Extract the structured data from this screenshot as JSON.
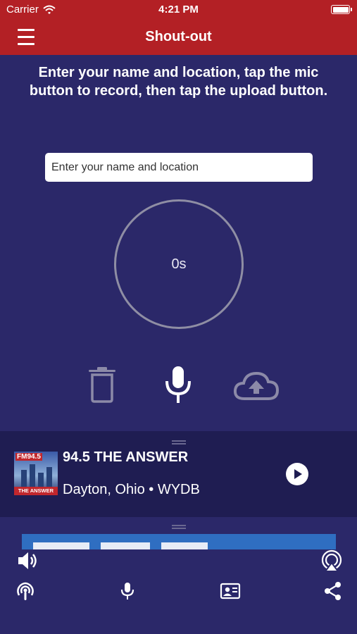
{
  "status_bar": {
    "carrier": "Carrier",
    "time": "4:21 PM"
  },
  "nav": {
    "title": "Shout-out"
  },
  "instructions": "Enter your name and location, tap the mic button to record, then tap the upload button.",
  "name_input": {
    "placeholder": "Enter your name and location",
    "value": ""
  },
  "recorder": {
    "elapsed": "0s"
  },
  "controls": {
    "icons": [
      "trash-icon",
      "microphone-icon",
      "cloud-upload-icon"
    ]
  },
  "player": {
    "station_name": "94.5 THE ANSWER",
    "location": "Dayton, Ohio • WYDB",
    "logo": {
      "fm": "FM94.5",
      "tag": "THE ANSWER"
    }
  },
  "bottom_bar": {
    "icons": [
      "speaker-icon",
      "airplay-icon",
      "podcast-icon",
      "microphone-icon",
      "contact-card-icon",
      "share-icon"
    ]
  },
  "colors": {
    "header": "#b32025",
    "background": "#2b2869",
    "player": "#1f1d52",
    "circle": "#8f8ea4"
  }
}
